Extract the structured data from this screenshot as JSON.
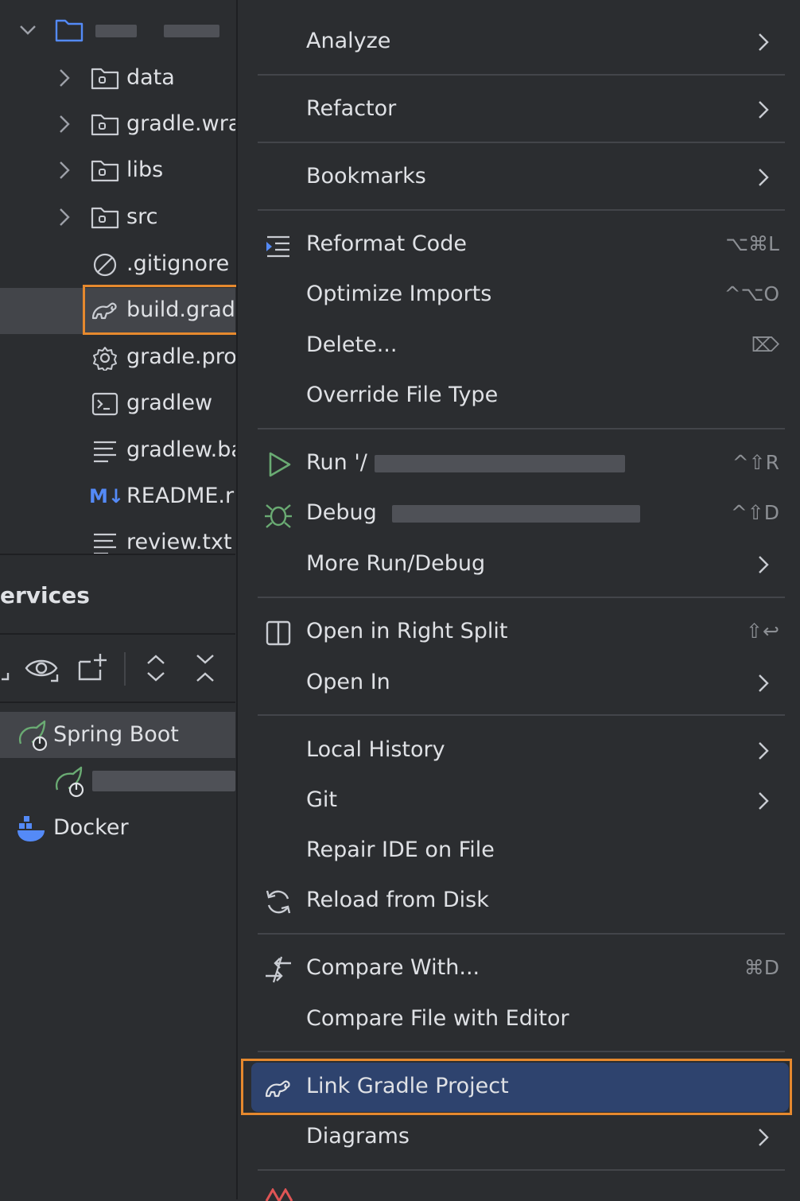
{
  "project_tree": {
    "items": [
      {
        "label": "data",
        "icon": "folder-icon"
      },
      {
        "label": "gradle.wra",
        "icon": "folder-icon"
      },
      {
        "label": "libs",
        "icon": "folder-icon"
      },
      {
        "label": "src",
        "icon": "folder-icon"
      },
      {
        "label": ".gitignore",
        "icon": "ignore-file-icon"
      },
      {
        "label": "build.grad",
        "icon": "gradle-icon"
      },
      {
        "label": "gradle.pro",
        "icon": "settings-file-icon"
      },
      {
        "label": "gradlew",
        "icon": "terminal-file-icon"
      },
      {
        "label": "gradlew.ba",
        "icon": "text-file-icon"
      },
      {
        "label": "README.r",
        "icon": "markdown-icon",
        "icon_text": "M↓"
      },
      {
        "label": "review.txt",
        "icon": "text-file-icon"
      }
    ]
  },
  "services": {
    "title": "ervices",
    "tree": [
      {
        "label": "Spring Boot",
        "icon": "spring-boot-icon"
      },
      {
        "label": "Docker",
        "icon": "docker-icon"
      }
    ]
  },
  "context_menu": {
    "items": [
      {
        "label": "Analyze",
        "submenu": true
      },
      {
        "label": "Refactor",
        "submenu": true
      },
      {
        "label": "Bookmarks",
        "submenu": true
      },
      {
        "label": "Reformat Code",
        "shortcut": "⌥⌘L",
        "icon": "reformat-icon"
      },
      {
        "label": "Optimize Imports",
        "shortcut": "^⌥O"
      },
      {
        "label": "Delete...",
        "shortcut": "⌦"
      },
      {
        "label": "Override File Type"
      },
      {
        "label": "Run '/",
        "shortcut": "^⇧R",
        "icon": "run-icon"
      },
      {
        "label": "Debug",
        "shortcut": "^⇧D",
        "icon": "debug-icon"
      },
      {
        "label": "More Run/Debug",
        "submenu": true
      },
      {
        "label": "Open in Right Split",
        "shortcut": "⇧↩",
        "icon": "split-icon"
      },
      {
        "label": "Open In",
        "submenu": true
      },
      {
        "label": "Local History",
        "submenu": true
      },
      {
        "label": "Git",
        "submenu": true
      },
      {
        "label": "Repair IDE on File"
      },
      {
        "label": "Reload from Disk",
        "icon": "reload-icon"
      },
      {
        "label": "Compare With...",
        "shortcut": "⌘D",
        "icon": "compare-icon"
      },
      {
        "label": "Compare File with Editor"
      },
      {
        "label": "Link Gradle Project",
        "icon": "gradle-icon",
        "highlighted": true
      },
      {
        "label": "Diagrams",
        "submenu": true
      }
    ]
  },
  "colors": {
    "background": "#2b2d30",
    "highlight": "#2e436e",
    "annotation_box": "#e6892e"
  }
}
